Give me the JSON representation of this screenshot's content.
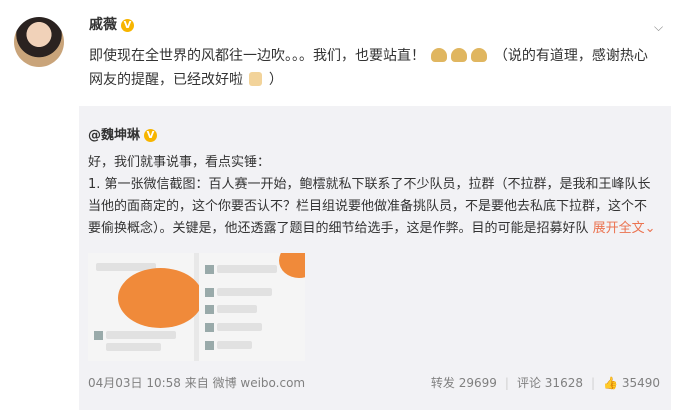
{
  "post": {
    "author": "戚薇",
    "badge": "V",
    "text": "即使现在全世界的风都往一边吹。。。我们，也要站直！",
    "text2": "（说的有道理，感谢热心网友的提醒，已经改好啦",
    "text_end": "）"
  },
  "quote": {
    "author": "@魏坤琳",
    "badge": "V",
    "line1": "好，我们就事说事，看点实锤：",
    "body": "1. 第一张微信截图：百人赛一开始，鲍橒就私下联系了不少队员，拉群（不拉群，是我和王峰队长当他的面商定的，这个你要否认不？栏目组说要他做准备挑队员，不是要他去私底下拉群，这个不要偷换概念）。关键是，他还透露了题目的细节给选手，这是作弊。目的可能是招募好队",
    "more": "展开全文",
    "more_icon": "chevron-down-icon",
    "date": "04月03日 10:58",
    "source": "来自 微博 weibo.com",
    "repost_label": "转发",
    "repost_count": "29699",
    "comment_label": "评论",
    "comment_count": "31628",
    "like_count": "35490"
  },
  "colors": {
    "link": "#eb7350",
    "badge": "#f7b500"
  }
}
